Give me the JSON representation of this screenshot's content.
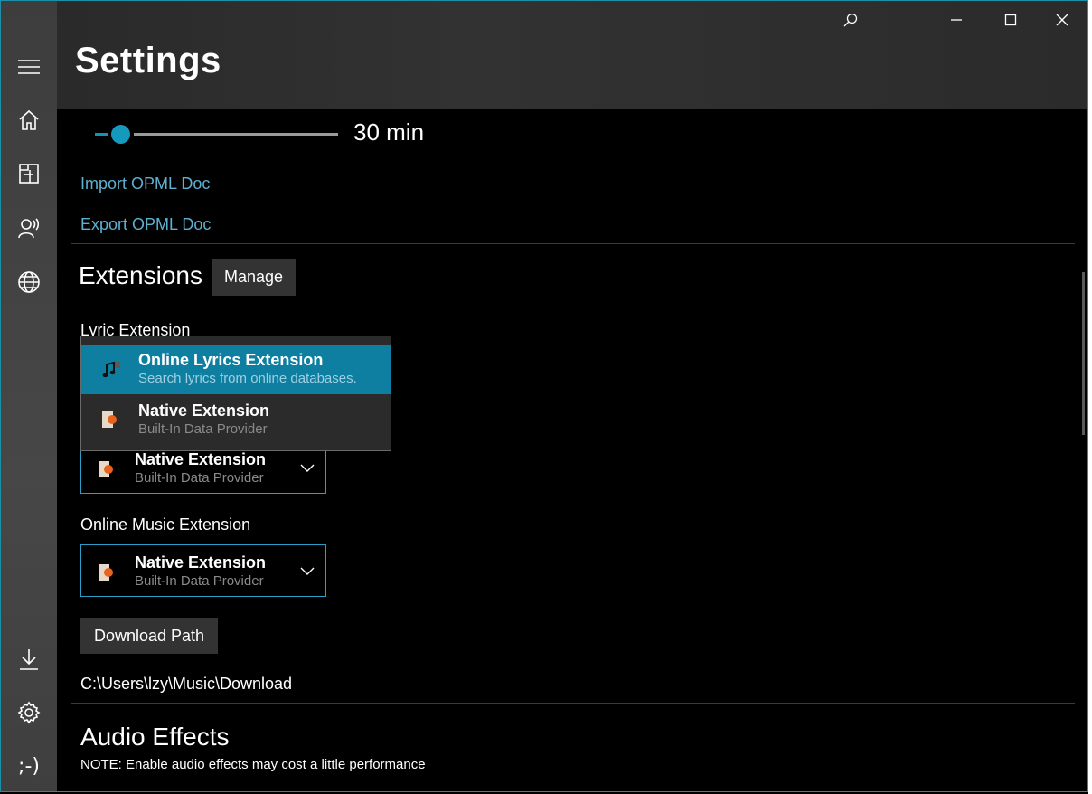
{
  "window": {
    "title": "Settings",
    "controls": {
      "search_icon": "search-icon",
      "minimize_icon": "minimize-icon",
      "maximize_icon": "maximize-icon",
      "close_icon": "close-icon"
    }
  },
  "rail": {
    "items": [
      {
        "icon": "hamburger-menu-icon"
      },
      {
        "icon": "home-icon"
      },
      {
        "icon": "library-icon"
      },
      {
        "icon": "podcast-icon"
      },
      {
        "icon": "globe-icon"
      },
      {
        "icon": "download-icon"
      },
      {
        "icon": "settings-gear-icon"
      }
    ],
    "emoticon": ";-)"
  },
  "timer": {
    "slider_value": 30,
    "value_label": "30 min"
  },
  "opml": {
    "import_label": "Import OPML Doc",
    "export_label": "Export OPML Doc"
  },
  "extensions": {
    "heading": "Extensions",
    "manage_label": "Manage",
    "lyric_label": "Lyric Extension",
    "dropdown_options": [
      {
        "title": "Online Lyrics Extension",
        "subtitle": "Search lyrics from online databases.",
        "icon": "music-note-icon",
        "selected": true
      },
      {
        "title": "Native Extension",
        "subtitle": "Built-In Data Provider",
        "icon": "native-extension-icon",
        "selected": false
      }
    ],
    "second_combo": {
      "title": "Native Extension",
      "subtitle": "Built-In Data Provider"
    },
    "online_music_label": "Online Music Extension",
    "online_music_combo": {
      "title": "Native Extension",
      "subtitle": "Built-In Data Provider"
    }
  },
  "download": {
    "button_label": "Download Path",
    "path": "C:\\Users\\lzy\\Music\\Download"
  },
  "audio": {
    "heading": "Audio Effects",
    "note": "NOTE: Enable audio effects may cost a little performance"
  },
  "colors": {
    "accent": "#1599bd",
    "link": "#5fb0d0",
    "selected_item": "#0f7fa1"
  }
}
